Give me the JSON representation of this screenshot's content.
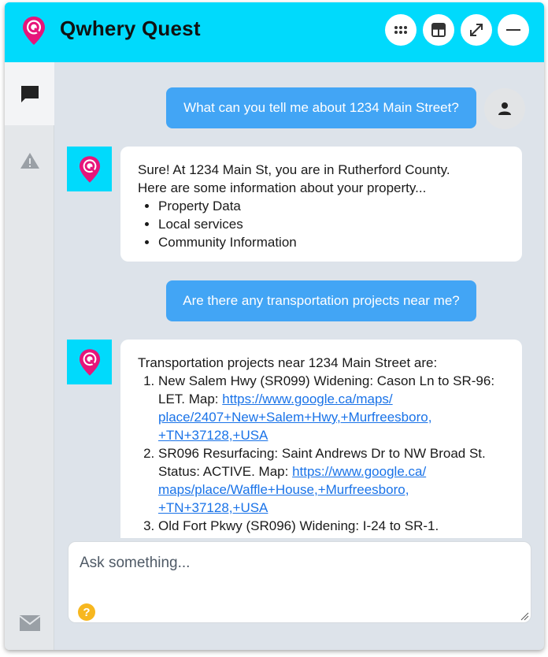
{
  "app": {
    "title": "Qwhery Quest",
    "brand_color": "#00dafc",
    "logo_color": "#e6157a"
  },
  "header": {
    "buttons": [
      {
        "name": "apps-grid-button",
        "icon": "grid-dots-icon"
      },
      {
        "name": "layout-button",
        "icon": "layout-icon"
      },
      {
        "name": "expand-button",
        "icon": "expand-arrows-icon"
      },
      {
        "name": "minimize-button",
        "icon": "minus-icon"
      }
    ]
  },
  "sidebar": {
    "items": [
      {
        "name": "chat",
        "icon": "chat-bubble-icon",
        "active": true
      },
      {
        "name": "alerts",
        "icon": "warning-icon",
        "active": false
      },
      {
        "name": "mail",
        "icon": "mail-icon",
        "active": false
      }
    ]
  },
  "messages": [
    {
      "role": "user",
      "text": "What can you tell me about 1234 Main Street?"
    },
    {
      "role": "bot",
      "intro_line1": "Sure! At 1234 Main St, you are in Rutherford County.",
      "intro_line2": "Here are some information about your property...",
      "bullets": [
        "Property Data",
        "Local services",
        "Community Information"
      ]
    },
    {
      "role": "user",
      "text": "Are there any transportation projects near me?"
    },
    {
      "role": "bot",
      "intro": "Transportation projects near 1234 Main Street are:",
      "items": [
        {
          "text": "New Salem Hwy (SR099) Widening: Cason Ln to SR-96: LET. Map: ",
          "link": "https://www.google.ca/maps/place/2407+New+Salem+Hwy,+Murfreesboro,+TN+37128,+USA",
          "link_display": [
            "https://www.google.ca/maps/",
            "place/2407+New+Salem+Hwy,+Murfreesboro,",
            "+TN+37128,+USA"
          ]
        },
        {
          "text": "SR096 Resurfacing: Saint Andrews Dr to NW Broad St. Status: ACTIVE. Map: ",
          "link": "https://www.google.ca/maps/place/Waffle+House,+Murfreesboro,+TN+37128,+USA",
          "link_display": [
            "https://www.google.ca/",
            "maps/place/Waffle+House,+Murfreesboro,",
            "+TN+37128,+USA"
          ]
        },
        {
          "text": "Old Fort Pkwy (SR096) Widening: I-24 to SR-1.",
          "link": "",
          "link_display": []
        }
      ]
    }
  ],
  "input": {
    "placeholder": "Ask something...",
    "value": "",
    "help_glyph": "?"
  }
}
